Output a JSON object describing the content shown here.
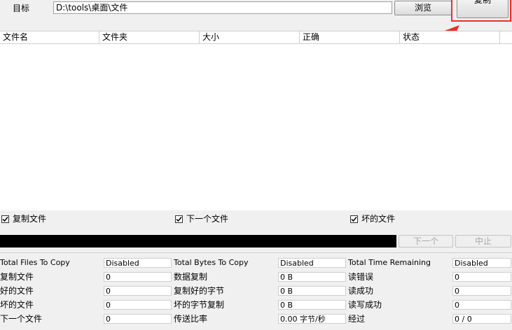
{
  "target": {
    "label": "目标",
    "path": "D:\\tools\\桌面\\文件"
  },
  "buttons": {
    "browse": "浏览",
    "copy": "复制",
    "next": "下一个",
    "stop": "中止"
  },
  "columns": [
    "文件名",
    "文件夹",
    "大小",
    "正确",
    "状态"
  ],
  "checkboxes": [
    {
      "label": "复制文件",
      "checked": true
    },
    {
      "label": "下一个文件",
      "checked": true
    },
    {
      "label": "坏的文件",
      "checked": true
    }
  ],
  "stats": {
    "col1": [
      {
        "label": "Total Files To Copy",
        "value": "Disabled"
      },
      {
        "label": "复制文件",
        "value": "0"
      },
      {
        "label": "好的文件",
        "value": "0"
      },
      {
        "label": "坏的文件",
        "value": "0"
      },
      {
        "label": "下一个文件",
        "value": "0"
      }
    ],
    "col2": [
      {
        "label": "Total Bytes To Copy",
        "value": "Disabled"
      },
      {
        "label": "数据复制",
        "value": "0 B"
      },
      {
        "label": "复制好的字节",
        "value": "0 B"
      },
      {
        "label": "坏的字节复制",
        "value": "0 B"
      },
      {
        "label": "传送比率",
        "value": "0.00 字节/秒"
      }
    ],
    "col3": [
      {
        "label": "Total Time Remaining",
        "value": "Disabled"
      },
      {
        "label": "读错误",
        "value": "0"
      },
      {
        "label": "读成功",
        "value": "0"
      },
      {
        "label": "读写成功",
        "value": "0"
      },
      {
        "label": "经过",
        "value": "0 / 0"
      }
    ]
  },
  "annotation": {
    "color": "#e8302a"
  }
}
